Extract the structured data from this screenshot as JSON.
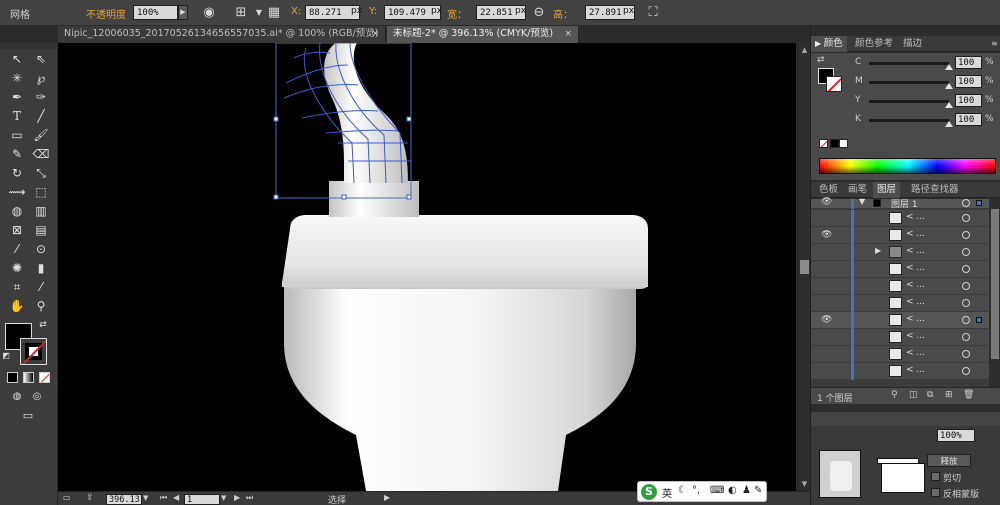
{
  "control_bar": {
    "mode_label": "网格",
    "opacity_label": "不透明度",
    "opacity_value": "100%",
    "x_label": "X:",
    "x_value": "88.271",
    "y_label": "Y:",
    "y_value": "109.479",
    "width_label": "宽：",
    "width_value": "22.851",
    "height_label": "高：",
    "height_value": "27.891",
    "unit": "px"
  },
  "tabs": [
    {
      "label": "Nipic_12006035_20170526134656557035.ai* @ 100% (RGB/预览)",
      "active": false
    },
    {
      "label": "未标题-2* @ 396.13% (CMYK/预览)",
      "active": true
    }
  ],
  "status": {
    "zoom": "396.13",
    "page": "1",
    "tool_label": "选择"
  },
  "color_panel": {
    "tabs": [
      "颜色",
      "颜色参考",
      "描边"
    ],
    "channels": [
      {
        "name": "C",
        "value": "100",
        "unit": "%"
      },
      {
        "name": "M",
        "value": "100",
        "unit": "%"
      },
      {
        "name": "Y",
        "value": "100",
        "unit": "%"
      },
      {
        "name": "K",
        "value": "100",
        "unit": "%"
      }
    ]
  },
  "layers_panel": {
    "tabs": [
      "色板",
      "画笔",
      "图层",
      "路径查找器"
    ],
    "top_layer": "图层 1",
    "row_name": "< ...",
    "footer": "1 个图层",
    "row_count": 11
  },
  "transparency_panel": {
    "opacity_value": "100%",
    "button_label": "释放",
    "clip_label": "剪切",
    "invert_label": "反相蒙版"
  },
  "ime": {
    "lang": "英"
  },
  "colors": {
    "accent_blue": "#4d6fbf",
    "orange": "#e8a23a",
    "canvas_bg": "#000000"
  }
}
